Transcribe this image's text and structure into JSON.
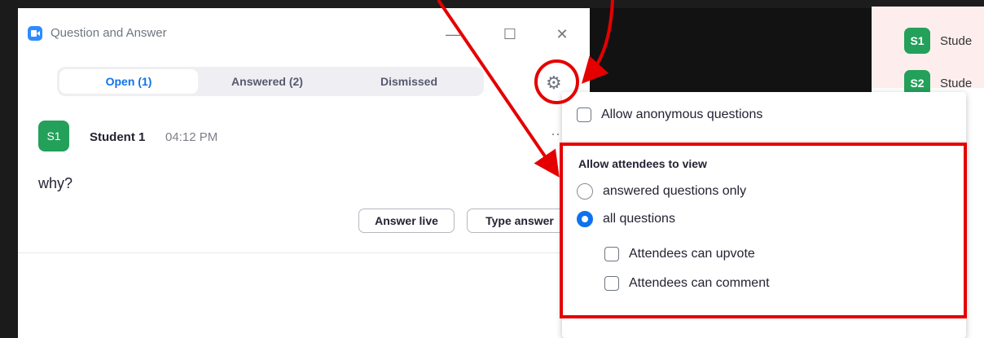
{
  "window": {
    "title": "Question and Answer",
    "minimize_glyph": "—",
    "maximize_glyph": "☐",
    "close_glyph": "✕"
  },
  "tabs": [
    {
      "label": "Open (1)",
      "active": true
    },
    {
      "label": "Answered (2)",
      "active": false
    },
    {
      "label": "Dismissed",
      "active": false
    }
  ],
  "question": {
    "avatar": "S1",
    "author": "Student 1",
    "time": "04:12 PM",
    "more": "···",
    "text": "why?",
    "answer_live_label": "Answer live",
    "type_answer_label": "Type answer"
  },
  "settings": {
    "gear_glyph": "⚙",
    "allow_anonymous": {
      "label": "Allow anonymous questions",
      "checked": false
    },
    "view_heading": "Allow attendees to view",
    "view_options": [
      {
        "label": "answered questions only",
        "selected": false
      },
      {
        "label": "all questions",
        "selected": true
      }
    ],
    "sub_options": [
      {
        "label": "Attendees can upvote",
        "checked": false
      },
      {
        "label": "Attendees can comment",
        "checked": false
      }
    ]
  },
  "participants": [
    {
      "avatar": "S1",
      "name": "Stude"
    },
    {
      "avatar": "S2",
      "name": "Stude"
    }
  ],
  "colors": {
    "accent": "#0e72ed",
    "avatar": "#23a05a",
    "annotation": "#e50000"
  }
}
